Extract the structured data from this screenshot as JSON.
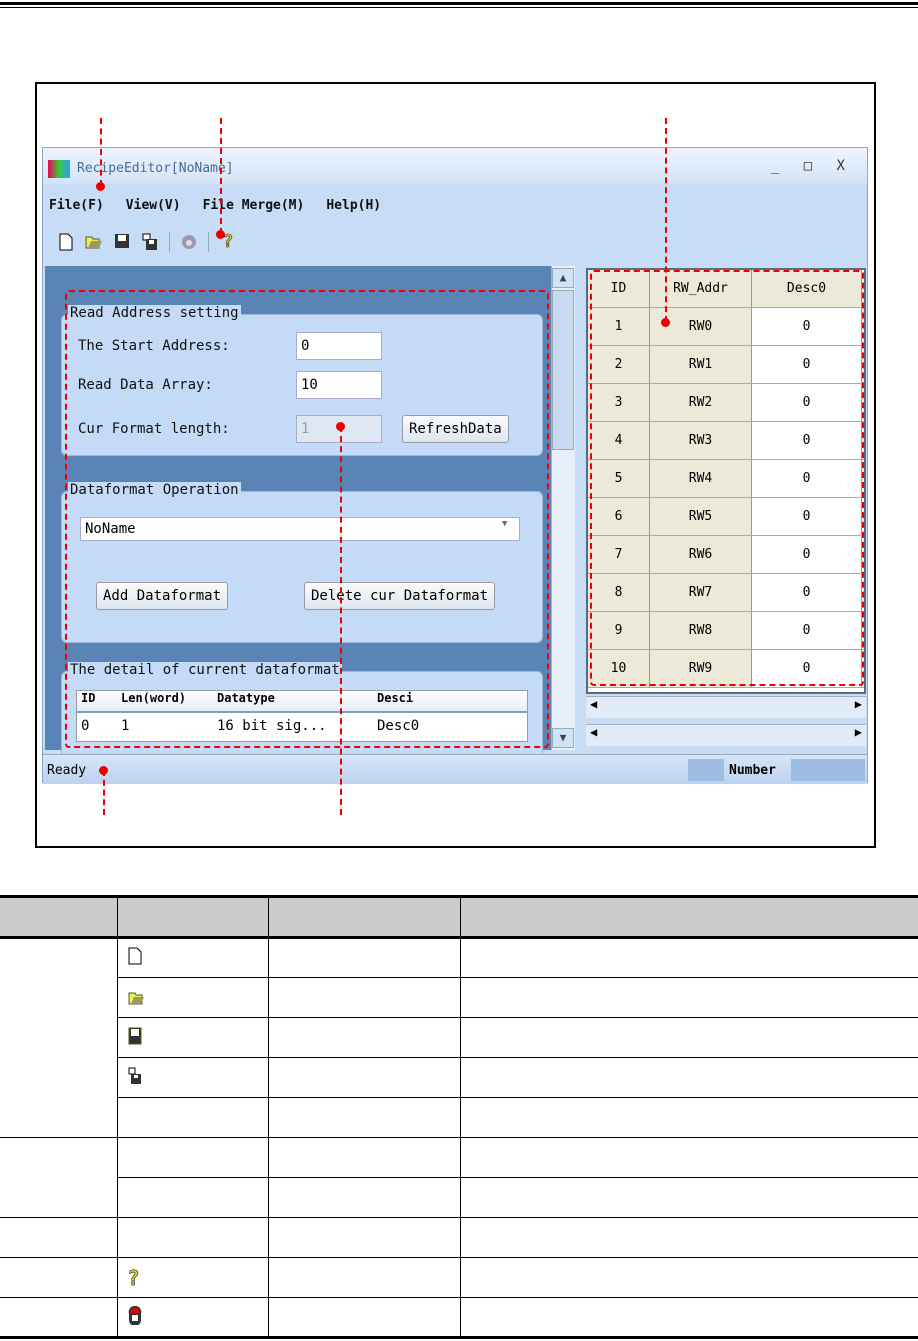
{
  "window": {
    "title": "RecipeEditor[NoName]",
    "controls": "_ □ X"
  },
  "menu": [
    "File(F)",
    "View(V)",
    "File Merge(M)",
    "Help(H)"
  ],
  "toolbar": [
    "new-file-icon",
    "open-folder-icon",
    "save-icon",
    "save-as-icon",
    "connect-icon",
    "help-icon"
  ],
  "read_group": {
    "title": "Read Address setting",
    "start_label": "The Start Address:",
    "start_value": "0",
    "array_label": "Read Data Array:",
    "array_value": "10",
    "format_label": "Cur Format length:",
    "format_value": "1",
    "refresh": "RefreshData"
  },
  "df_group": {
    "title": "Dataformat Operation",
    "selected": "NoName",
    "add": "Add Dataformat",
    "delete": "Delete cur Dataformat"
  },
  "detail": {
    "title": "The detail of current dataformat",
    "headers": [
      "ID",
      "Len(word)",
      "Datatype",
      "Desci"
    ],
    "row": [
      "0",
      "1",
      "16 bit sig...",
      "Desc0"
    ]
  },
  "grid": {
    "headers": [
      "ID",
      "RW_Addr",
      "Desc0"
    ],
    "rows": [
      [
        "1",
        "RW0",
        "0"
      ],
      [
        "2",
        "RW1",
        "0"
      ],
      [
        "3",
        "RW2",
        "0"
      ],
      [
        "4",
        "RW3",
        "0"
      ],
      [
        "5",
        "RW4",
        "0"
      ],
      [
        "6",
        "RW5",
        "0"
      ],
      [
        "7",
        "RW6",
        "0"
      ],
      [
        "8",
        "RW7",
        "0"
      ],
      [
        "9",
        "RW8",
        "0"
      ],
      [
        "10",
        "RW9",
        "0"
      ]
    ]
  },
  "status": {
    "text": "Ready",
    "number": "Number"
  },
  "colors": {
    "annotation": "#e00000",
    "window": "#c7dcf5",
    "grid_header": "#ece9d8"
  },
  "table_icons": [
    "new-file-icon",
    "open-folder-icon",
    "save-icon",
    "save-as-icon",
    "",
    "",
    "",
    "",
    "help-icon",
    "connect-icon"
  ]
}
